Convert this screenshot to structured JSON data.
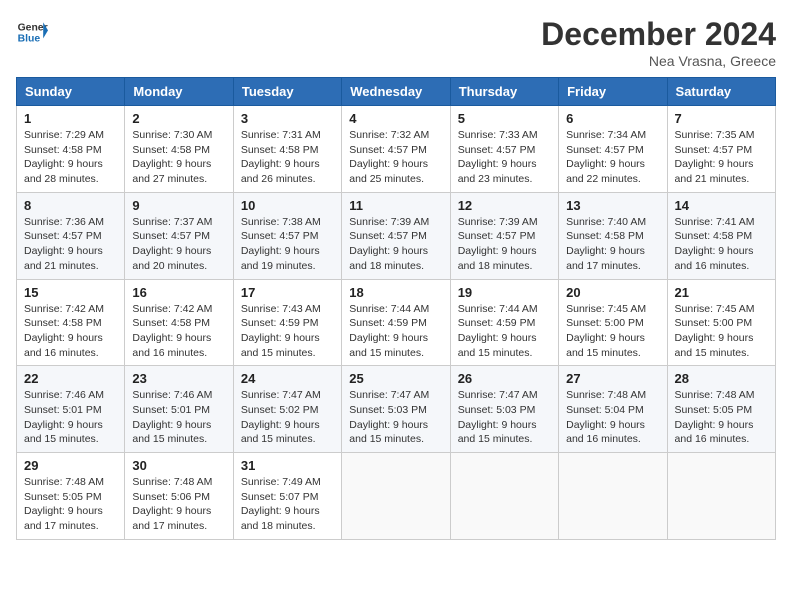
{
  "header": {
    "logo_line1": "General",
    "logo_line2": "Blue",
    "month_title": "December 2024",
    "location": "Nea Vrasna, Greece"
  },
  "days_of_week": [
    "Sunday",
    "Monday",
    "Tuesday",
    "Wednesday",
    "Thursday",
    "Friday",
    "Saturday"
  ],
  "weeks": [
    [
      {
        "day": "1",
        "info": "Sunrise: 7:29 AM\nSunset: 4:58 PM\nDaylight: 9 hours and 28 minutes."
      },
      {
        "day": "2",
        "info": "Sunrise: 7:30 AM\nSunset: 4:58 PM\nDaylight: 9 hours and 27 minutes."
      },
      {
        "day": "3",
        "info": "Sunrise: 7:31 AM\nSunset: 4:58 PM\nDaylight: 9 hours and 26 minutes."
      },
      {
        "day": "4",
        "info": "Sunrise: 7:32 AM\nSunset: 4:57 PM\nDaylight: 9 hours and 25 minutes."
      },
      {
        "day": "5",
        "info": "Sunrise: 7:33 AM\nSunset: 4:57 PM\nDaylight: 9 hours and 23 minutes."
      },
      {
        "day": "6",
        "info": "Sunrise: 7:34 AM\nSunset: 4:57 PM\nDaylight: 9 hours and 22 minutes."
      },
      {
        "day": "7",
        "info": "Sunrise: 7:35 AM\nSunset: 4:57 PM\nDaylight: 9 hours and 21 minutes."
      }
    ],
    [
      {
        "day": "8",
        "info": "Sunrise: 7:36 AM\nSunset: 4:57 PM\nDaylight: 9 hours and 21 minutes."
      },
      {
        "day": "9",
        "info": "Sunrise: 7:37 AM\nSunset: 4:57 PM\nDaylight: 9 hours and 20 minutes."
      },
      {
        "day": "10",
        "info": "Sunrise: 7:38 AM\nSunset: 4:57 PM\nDaylight: 9 hours and 19 minutes."
      },
      {
        "day": "11",
        "info": "Sunrise: 7:39 AM\nSunset: 4:57 PM\nDaylight: 9 hours and 18 minutes."
      },
      {
        "day": "12",
        "info": "Sunrise: 7:39 AM\nSunset: 4:57 PM\nDaylight: 9 hours and 18 minutes."
      },
      {
        "day": "13",
        "info": "Sunrise: 7:40 AM\nSunset: 4:58 PM\nDaylight: 9 hours and 17 minutes."
      },
      {
        "day": "14",
        "info": "Sunrise: 7:41 AM\nSunset: 4:58 PM\nDaylight: 9 hours and 16 minutes."
      }
    ],
    [
      {
        "day": "15",
        "info": "Sunrise: 7:42 AM\nSunset: 4:58 PM\nDaylight: 9 hours and 16 minutes."
      },
      {
        "day": "16",
        "info": "Sunrise: 7:42 AM\nSunset: 4:58 PM\nDaylight: 9 hours and 16 minutes."
      },
      {
        "day": "17",
        "info": "Sunrise: 7:43 AM\nSunset: 4:59 PM\nDaylight: 9 hours and 15 minutes."
      },
      {
        "day": "18",
        "info": "Sunrise: 7:44 AM\nSunset: 4:59 PM\nDaylight: 9 hours and 15 minutes."
      },
      {
        "day": "19",
        "info": "Sunrise: 7:44 AM\nSunset: 4:59 PM\nDaylight: 9 hours and 15 minutes."
      },
      {
        "day": "20",
        "info": "Sunrise: 7:45 AM\nSunset: 5:00 PM\nDaylight: 9 hours and 15 minutes."
      },
      {
        "day": "21",
        "info": "Sunrise: 7:45 AM\nSunset: 5:00 PM\nDaylight: 9 hours and 15 minutes."
      }
    ],
    [
      {
        "day": "22",
        "info": "Sunrise: 7:46 AM\nSunset: 5:01 PM\nDaylight: 9 hours and 15 minutes."
      },
      {
        "day": "23",
        "info": "Sunrise: 7:46 AM\nSunset: 5:01 PM\nDaylight: 9 hours and 15 minutes."
      },
      {
        "day": "24",
        "info": "Sunrise: 7:47 AM\nSunset: 5:02 PM\nDaylight: 9 hours and 15 minutes."
      },
      {
        "day": "25",
        "info": "Sunrise: 7:47 AM\nSunset: 5:03 PM\nDaylight: 9 hours and 15 minutes."
      },
      {
        "day": "26",
        "info": "Sunrise: 7:47 AM\nSunset: 5:03 PM\nDaylight: 9 hours and 15 minutes."
      },
      {
        "day": "27",
        "info": "Sunrise: 7:48 AM\nSunset: 5:04 PM\nDaylight: 9 hours and 16 minutes."
      },
      {
        "day": "28",
        "info": "Sunrise: 7:48 AM\nSunset: 5:05 PM\nDaylight: 9 hours and 16 minutes."
      }
    ],
    [
      {
        "day": "29",
        "info": "Sunrise: 7:48 AM\nSunset: 5:05 PM\nDaylight: 9 hours and 17 minutes."
      },
      {
        "day": "30",
        "info": "Sunrise: 7:48 AM\nSunset: 5:06 PM\nDaylight: 9 hours and 17 minutes."
      },
      {
        "day": "31",
        "info": "Sunrise: 7:49 AM\nSunset: 5:07 PM\nDaylight: 9 hours and 18 minutes."
      },
      null,
      null,
      null,
      null
    ]
  ]
}
